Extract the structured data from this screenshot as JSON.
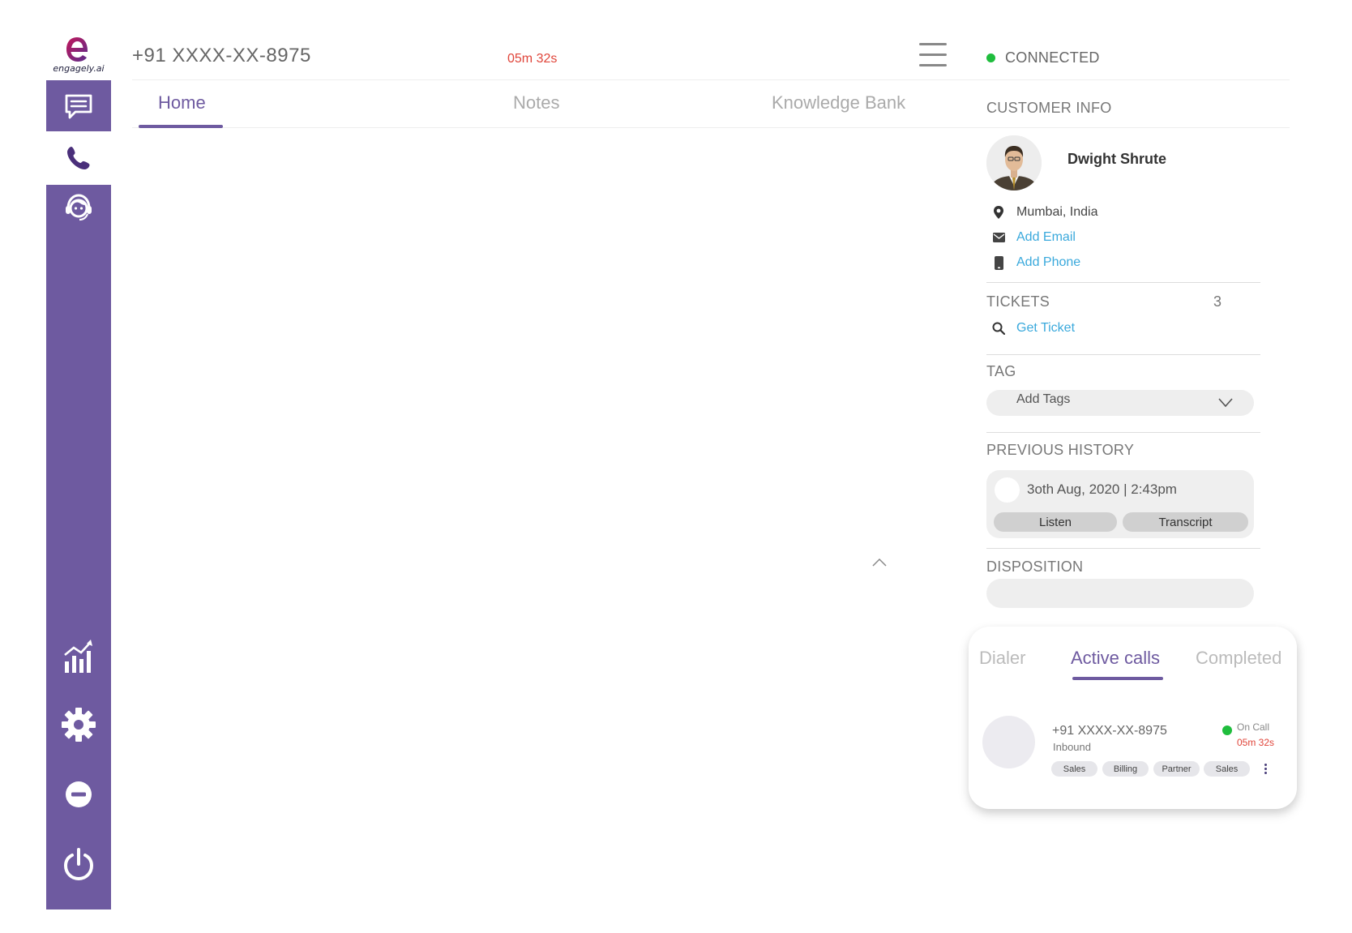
{
  "brand": {
    "logo_text": "engagely.ai",
    "accent_color": "#6e5aa0"
  },
  "sidebar": {
    "items": [
      {
        "icon": "chat-icon",
        "active": false
      },
      {
        "icon": "phone-icon",
        "active": true
      },
      {
        "icon": "agent-headset-icon",
        "active": false
      },
      {
        "icon": "analytics-icon",
        "active": false
      },
      {
        "icon": "gear-icon",
        "active": false
      },
      {
        "icon": "do-not-disturb-icon",
        "active": false
      },
      {
        "icon": "power-icon",
        "active": false
      }
    ]
  },
  "header": {
    "phone": "+91 XXXX-XX-8975",
    "timer": "05m 32s",
    "status": "CONNECTED",
    "status_color": "#1fbd3d"
  },
  "tabs": [
    {
      "label": "Home",
      "active": true
    },
    {
      "label": "Notes",
      "active": false
    },
    {
      "label": "Knowledge Bank",
      "active": false
    }
  ],
  "customer": {
    "section_title": "CUSTOMER INFO",
    "name": "Dwight Shrute",
    "location": "Mumbai, India",
    "add_email": "Add Email",
    "add_phone": "Add Phone"
  },
  "tickets": {
    "title": "TICKETS",
    "count": "3",
    "get_ticket": "Get Ticket"
  },
  "tag": {
    "title": "TAG",
    "placeholder": "Add Tags"
  },
  "history": {
    "title": "PREVIOUS HISTORY",
    "datetime": "3oth Aug, 2020  |  2:43pm",
    "listen": "Listen",
    "transcript": "Transcript"
  },
  "disposition": {
    "title": "DISPOSITION",
    "value": ""
  },
  "calls_panel": {
    "tabs": [
      {
        "label": "Dialer",
        "active": false
      },
      {
        "label": "Active calls",
        "active": true
      },
      {
        "label": "Completed",
        "active": false
      }
    ],
    "call": {
      "number": "+91 XXXX-XX-8975",
      "direction": "Inbound",
      "status": "On Call",
      "timer": "05m 32s",
      "tags": [
        "Sales",
        "Billing",
        "Partner",
        "Sales"
      ]
    }
  }
}
